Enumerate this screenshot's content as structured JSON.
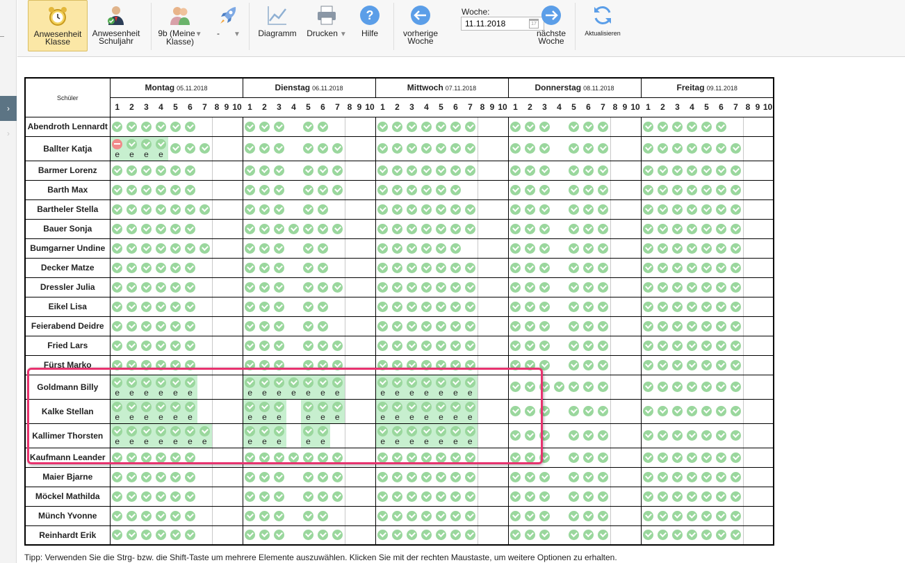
{
  "toolbar": {
    "anwesenheit_klasse": [
      "Anwesenheit",
      "Klasse"
    ],
    "anwesenheit_schuljahr": [
      "Anwesenheit",
      "Schuljahr"
    ],
    "klasse_select": [
      "9b (Meine",
      "Klasse)"
    ],
    "filter_select": "-",
    "diagramm": "Diagramm",
    "drucken": "Drucken",
    "hilfe": "Hilfe",
    "vorherige": [
      "vorherige",
      "Woche"
    ],
    "woche_label": "Woche:",
    "woche_value": "11.11.2018",
    "naechste": [
      "nächste",
      "Woche"
    ],
    "aktualisieren": "Aktualisieren"
  },
  "grid": {
    "schueler_header": "Schüler",
    "lesson_numbers": [
      "1",
      "2",
      "3",
      "4",
      "5",
      "6",
      "7",
      "8",
      "9",
      "10"
    ],
    "days": [
      {
        "name": "Montag",
        "date": "05.11.2018"
      },
      {
        "name": "Dienstag",
        "date": "06.11.2018"
      },
      {
        "name": "Mittwoch",
        "date": "07.11.2018"
      },
      {
        "name": "Donnerstag",
        "date": "08.11.2018"
      },
      {
        "name": "Freitag",
        "date": "09.11.2018"
      }
    ],
    "status_legend": {
      "ok": "present",
      "ab": "absent",
      "e": "e"
    },
    "students": [
      {
        "name": "Abendroth Lennardt",
        "days": [
          "oooooo",
          "ooo_oo",
          "ooooooo",
          "ooo_ooo",
          "oooooo"
        ]
      },
      {
        "name": "Ballter Katja",
        "days": [
          "A[e]o[e]o[e]o[e]ooo",
          "ooo_ooo",
          "ooooooo",
          "ooo_ooo",
          "ooooooo"
        ]
      },
      {
        "name": "Barmer Lorenz",
        "days": [
          "oooooo",
          "ooo_ooo",
          "ooooooo",
          "ooo_ooo",
          "ooooooo"
        ]
      },
      {
        "name": "Barth Max",
        "days": [
          "oooooo",
          "ooo_ooo",
          "oooooo",
          "ooo_ooo",
          "ooooooo"
        ]
      },
      {
        "name": "Bartheler Stella",
        "days": [
          "ooooooo",
          "ooo_oo",
          "ooooooo",
          "ooo_ooo",
          "ooooooo"
        ]
      },
      {
        "name": "Bauer Sonja",
        "days": [
          "oooooo",
          "ooooooo",
          "ooooooo",
          "ooo_ooo",
          "ooooooo"
        ]
      },
      {
        "name": "Bumgarner Undine",
        "days": [
          "ooooooo",
          "ooo_oo",
          "oooooo",
          "ooo_ooo",
          "ooooooo"
        ]
      },
      {
        "name": "Decker Matze",
        "days": [
          "oooooo",
          "ooo_oo",
          "ooooooo",
          "ooo_ooo",
          "ooooooo"
        ]
      },
      {
        "name": "Dressler Julia",
        "days": [
          "oooooo",
          "ooo_ooo",
          "ooooooo",
          "ooo_ooo",
          "ooooooo"
        ]
      },
      {
        "name": "Eikel Lisa",
        "days": [
          "oooooo",
          "ooo_oo",
          "ooooooo",
          "ooo_ooo",
          "ooooooo"
        ]
      },
      {
        "name": "Feierabend Deidre",
        "days": [
          "oooooo",
          "ooo_oo",
          "ooooooo",
          "ooo_ooo",
          "ooooooo"
        ]
      },
      {
        "name": "Fried Lars",
        "days": [
          "oooooo",
          "ooo_ooo",
          "ooooooo",
          "ooo_ooo",
          "ooooooo"
        ]
      },
      {
        "name": "Fürst Marko",
        "days": [
          "oooooo",
          "ooo_ooo",
          "ooooooo",
          "ooo_ooo",
          "ooooooo"
        ]
      },
      {
        "name": "Goldmann Billy",
        "days": [
          "EEEEEE",
          "EEEEEEE",
          "EEEEEEE",
          "ooooooo",
          "ooooooo"
        ]
      },
      {
        "name": "Kalke Stellan",
        "days": [
          "EEEEEE",
          "EEE_EEE",
          "EEEEEEE",
          "ooo_ooo",
          "ooooooo"
        ]
      },
      {
        "name": "Kallimer Thorsten",
        "days": [
          "EEEEEEE",
          "EEE_EE",
          "EEEEEEE",
          "ooo_ooo",
          "ooooooo"
        ]
      },
      {
        "name": "Kaufmann Leander",
        "days": [
          "oooooo",
          "ooooooo",
          "ooooooo",
          "ooo_ooo",
          "ooooooo"
        ]
      },
      {
        "name": "Maier Bjarne",
        "days": [
          "oooooo",
          "ooo_ooo",
          "ooooooo",
          "ooo_ooo",
          "ooooooo"
        ]
      },
      {
        "name": "Möckel Mathilda",
        "days": [
          "oooooo",
          "ooo_ooo",
          "ooooooo",
          "ooo_ooo",
          "ooooooo"
        ]
      },
      {
        "name": "Münch Yvonne",
        "days": [
          "oooooo",
          "ooo_oo",
          "ooooooo",
          "ooo_ooo",
          "ooooooo"
        ]
      },
      {
        "name": "Reinhardt Erik",
        "days": [
          "oooooo",
          "ooo_ooo",
          "ooooooo",
          "ooo_ooo",
          "ooooooo"
        ]
      }
    ]
  },
  "tipp": "Tipp: Verwenden Sie die Strg- bzw. die Shift-Taste um mehrere Elemente auszuwählen. Klicken Sie mit der rechten Maustaste, um weitere Optionen zu erhalten."
}
